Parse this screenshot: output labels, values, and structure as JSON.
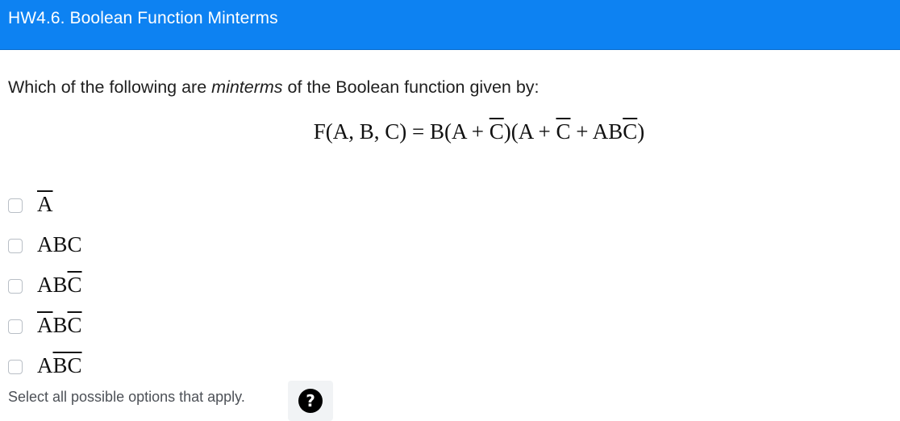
{
  "header": {
    "title": "HW4.6. Boolean Function Minterms",
    "background_color": "#0d82f2"
  },
  "question": {
    "prefix": "Which of the following are ",
    "emphasis": "minterms",
    "suffix": " of the Boolean function given by:"
  },
  "equation": {
    "lhs": "F(A, B, C) = B(A + ",
    "c_bar_1": "C",
    "mid_1": ")(A + ",
    "c_bar_2": "C",
    "mid_2": " + AB",
    "c_bar_3": "C",
    "end": ")"
  },
  "options": [
    {
      "parts": [
        {
          "text": "A",
          "bar": true
        }
      ]
    },
    {
      "parts": [
        {
          "text": "ABC",
          "bar": false
        }
      ]
    },
    {
      "parts": [
        {
          "text": "AB",
          "bar": false
        },
        {
          "text": "C",
          "bar": true
        }
      ]
    },
    {
      "parts": [
        {
          "text": "A",
          "bar": true
        },
        {
          "text": "B",
          "bar": false
        },
        {
          "text": "C",
          "bar": true
        }
      ]
    },
    {
      "parts": [
        {
          "text": "A",
          "bar": false
        },
        {
          "text": "B",
          "bar": true
        },
        {
          "text": "C",
          "bar": true
        }
      ]
    }
  ],
  "hint": "Select all possible options that apply.",
  "help_icon": "question-circle-icon"
}
